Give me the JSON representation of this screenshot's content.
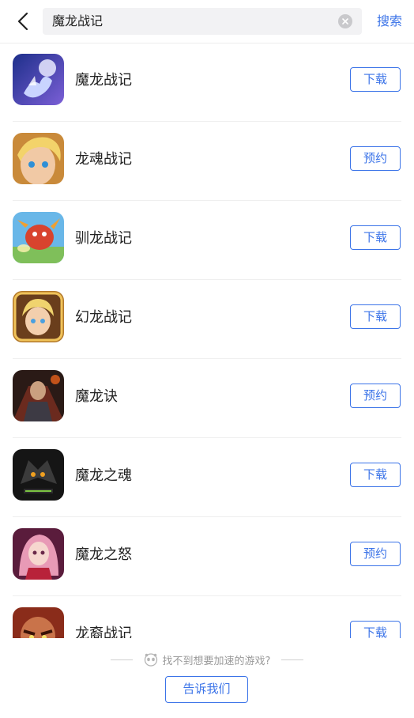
{
  "header": {
    "search_value": "魔龙战记",
    "search_button": "搜索"
  },
  "results": [
    {
      "name": "魔龙战记",
      "action": "下载",
      "icon": "night-rider-game-icon"
    },
    {
      "name": "龙魂战记",
      "action": "预约",
      "icon": "blond-hero-game-icon"
    },
    {
      "name": "驯龙战记",
      "action": "下载",
      "icon": "red-dragon-game-icon"
    },
    {
      "name": "幻龙战记",
      "action": "下载",
      "icon": "golden-heroine-game-icon"
    },
    {
      "name": "魔龙诀",
      "action": "预约",
      "icon": "dark-warrior-game-icon"
    },
    {
      "name": "魔龙之魂",
      "action": "下载",
      "icon": "dark-dragon-game-icon"
    },
    {
      "name": "魔龙之怒",
      "action": "预约",
      "icon": "pink-heroine-game-icon"
    },
    {
      "name": "龙裔战记",
      "action": "下载",
      "icon": "angry-warrior-game-icon"
    }
  ],
  "footer": {
    "hint": "找不到想要加速的游戏?",
    "tell_us": "告诉我们"
  },
  "colors": {
    "accent": "#3c74e8",
    "divider": "#efefef",
    "search_bg": "#f2f2f4"
  }
}
